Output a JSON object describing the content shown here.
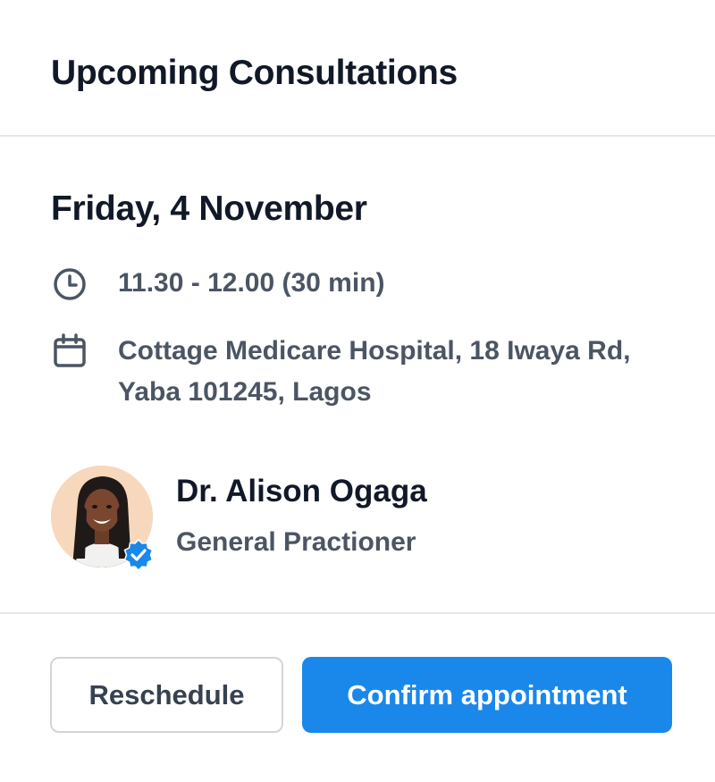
{
  "header": {
    "title": "Upcoming Consultations"
  },
  "appointment": {
    "date": "Friday, 4 November",
    "time": "11.30 - 12.00 (30 min)",
    "location_line1": "Cottage Medicare Hospital, 18 Iwaya Rd,",
    "location_line2": "Yaba 101245, Lagos"
  },
  "doctor": {
    "name": "Dr. Alison Ogaga",
    "role": "General Practioner",
    "verified": true
  },
  "actions": {
    "reschedule_label": "Reschedule",
    "confirm_label": "Confirm appointment"
  },
  "icons": {
    "time": "clock-icon",
    "location": "calendar-icon",
    "verified": "verified-badge-icon"
  },
  "colors": {
    "primary": "#1a88ea",
    "text_dark": "#111827",
    "text_muted": "#4b5563",
    "divider": "#e5e7eb"
  }
}
